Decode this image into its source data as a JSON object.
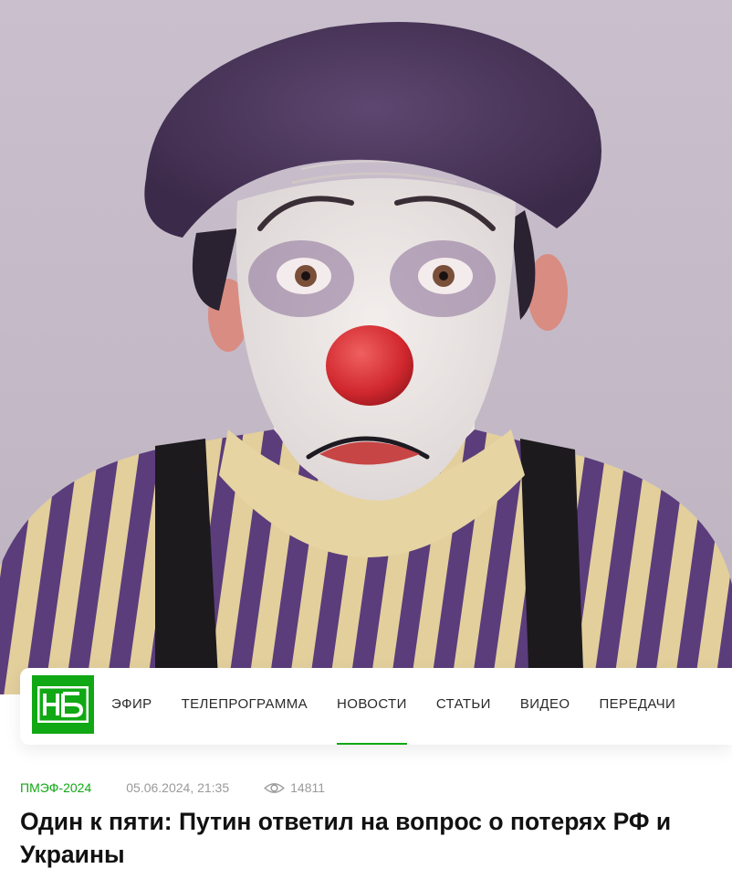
{
  "hero_image": {
    "icon": "sad-clown-photo"
  },
  "logo": {
    "icon": "ntv-logo",
    "color": "#10a814"
  },
  "nav": {
    "items": [
      {
        "label": "ЭФИР"
      },
      {
        "label": "ТЕЛЕПРОГРАММА"
      },
      {
        "label": "НОВОСТИ",
        "active": true
      },
      {
        "label": "СТАТЬИ"
      },
      {
        "label": "ВИДЕО"
      },
      {
        "label": "ПЕРЕДАЧИ"
      }
    ]
  },
  "article": {
    "tag": "ПМЭФ-2024",
    "date": "05.06.2024, 21:35",
    "views": "14811",
    "views_icon": "eye-icon",
    "headline": "Один к пяти: Путин ответил на вопрос о потерях РФ и Украины"
  },
  "colors": {
    "accent": "#10a814",
    "meta_gray": "#9a9a9a"
  }
}
